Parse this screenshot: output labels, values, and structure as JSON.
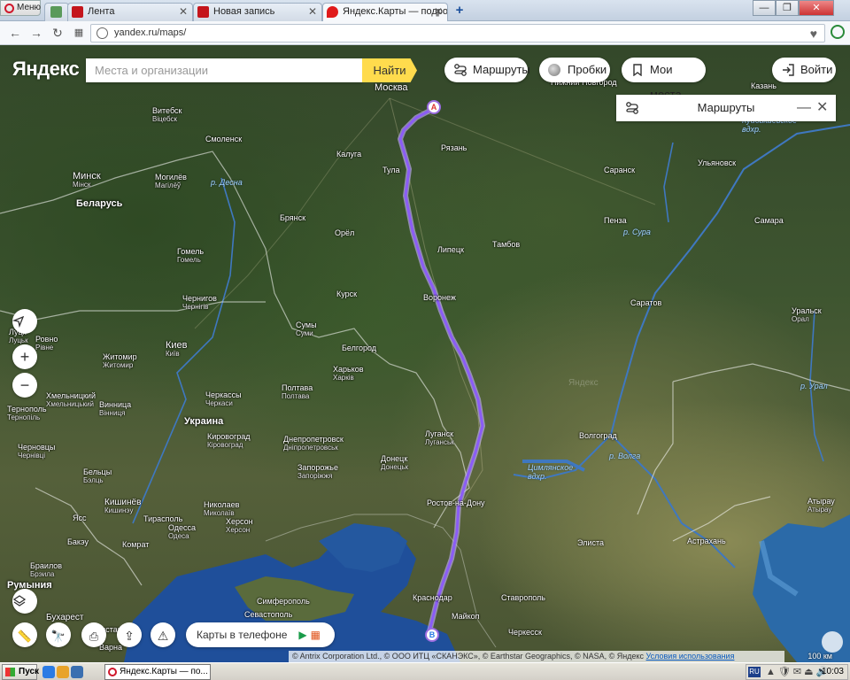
{
  "browser": {
    "menu_label": "Меню",
    "tabs": [
      {
        "label": "",
        "favicon": "speed-dial-icon"
      },
      {
        "label": "Лента",
        "favicon": "drive2-icon"
      },
      {
        "label": "Новая запись",
        "favicon": "drive2-icon"
      },
      {
        "label": "Яндекс.Карты — подробна",
        "favicon": "map-pin-icon"
      }
    ],
    "new_tab": "+",
    "url": "yandex.ru/maps/"
  },
  "header": {
    "logo": "Яндекс",
    "search_placeholder": "Места и организации",
    "find_label": "Найти",
    "routes_label": "Маршруты",
    "traffic_label": "Пробки",
    "myplaces_label": "Мои места",
    "login_label": "Войти"
  },
  "route_panel": {
    "title": "Маршруты"
  },
  "map": {
    "countries": [
      "Беларусь",
      "Украина",
      "Румыния"
    ],
    "water": [
      "р. Десна",
      "р. Сура",
      "р. Волга",
      "Цимлянское вдхр.",
      "Куйбышевское вдхр.",
      "р. Урал"
    ],
    "cities": [
      {
        "name": "Москва"
      },
      {
        "name": "Рязань"
      },
      {
        "name": "Калуга"
      },
      {
        "name": "Тула"
      },
      {
        "name": "Смоленск"
      },
      {
        "name": "Витебск",
        "sub": "Віцебск"
      },
      {
        "name": "Минск",
        "sub": "Мінск"
      },
      {
        "name": "Могилёв",
        "sub": "Магілёў"
      },
      {
        "name": "Брянск"
      },
      {
        "name": "Орёл"
      },
      {
        "name": "Липецк"
      },
      {
        "name": "Тамбов"
      },
      {
        "name": "Пенза"
      },
      {
        "name": "Саранск"
      },
      {
        "name": "Ульяновск"
      },
      {
        "name": "Самара"
      },
      {
        "name": "Казань"
      },
      {
        "name": "Нижний Новгород"
      },
      {
        "name": "Гомель",
        "sub": "Гомель"
      },
      {
        "name": "Курск"
      },
      {
        "name": "Воронеж"
      },
      {
        "name": "Саратов"
      },
      {
        "name": "Уральск",
        "sub": "Орал"
      },
      {
        "name": "Чернигов",
        "sub": "Чернігів"
      },
      {
        "name": "Сумы",
        "sub": "Суми"
      },
      {
        "name": "Белгород"
      },
      {
        "name": "Киев",
        "sub": "Київ"
      },
      {
        "name": "Житомир",
        "sub": "Житомир"
      },
      {
        "name": "Луцк",
        "sub": "Луцьк"
      },
      {
        "name": "Ровно",
        "sub": "Рівне"
      },
      {
        "name": "Харьков",
        "sub": "Харків"
      },
      {
        "name": "Полтава",
        "sub": "Полтава"
      },
      {
        "name": "Черкассы",
        "sub": "Черкаси"
      },
      {
        "name": "Хмельницкий",
        "sub": "Хмельницький"
      },
      {
        "name": "Винница",
        "sub": "Вінниця"
      },
      {
        "name": "Тернополь",
        "sub": "Тернопіль"
      },
      {
        "name": "Кировоград",
        "sub": "Кіровоград"
      },
      {
        "name": "Днепропетровск",
        "sub": "Дніпропетровськ"
      },
      {
        "name": "Луганск",
        "sub": "Луганськ"
      },
      {
        "name": "Донецк",
        "sub": "Донецьк"
      },
      {
        "name": "Запорожье",
        "sub": "Запоріжжя"
      },
      {
        "name": "Волгоград"
      },
      {
        "name": "Черновцы",
        "sub": "Чернівці"
      },
      {
        "name": "Бельцы",
        "sub": "Бэлць"
      },
      {
        "name": "Кишинёв",
        "sub": "Кишинэу"
      },
      {
        "name": "Николаев",
        "sub": "Миколаїв"
      },
      {
        "name": "Херсон",
        "sub": "Херсон"
      },
      {
        "name": "Одесса",
        "sub": "Одеса"
      },
      {
        "name": "Тирасполь"
      },
      {
        "name": "Ростов-на-Дону"
      },
      {
        "name": "Элиста"
      },
      {
        "name": "Астрахань"
      },
      {
        "name": "Атырау",
        "sub": "Атырау"
      },
      {
        "name": "Симферополь"
      },
      {
        "name": "Севастополь"
      },
      {
        "name": "Краснодар"
      },
      {
        "name": "Майкоп"
      },
      {
        "name": "Ставрополь"
      },
      {
        "name": "Черкесск"
      },
      {
        "name": "Бухарест"
      },
      {
        "name": "Констанца"
      },
      {
        "name": "Варна"
      },
      {
        "name": "Браилов",
        "sub": "Брэила"
      },
      {
        "name": "Комрат"
      },
      {
        "name": "Бакэу"
      },
      {
        "name": "Ясс"
      },
      {
        "name": "Ровно"
      }
    ],
    "marker_a": "A",
    "marker_b": "B",
    "watermark": "Яндекс"
  },
  "controls": {
    "locate": "locate-icon",
    "zoom_in": "+",
    "zoom_out": "−"
  },
  "app_banner": {
    "label": "Карты в телефоне",
    "icons": "  ▶ ▦"
  },
  "copyright": {
    "text": "© Antrix Corporation Ltd., © ООО ИТЦ «СКАНЭКС», © Earthstar Geographics, © NASA, © Яндекс",
    "link": "Условия использования"
  },
  "scale_label": "100 км",
  "taskbar": {
    "start": "Пуск",
    "task_label": "Яндекс.Карты — по...",
    "lang": "RU",
    "clock": "10:03"
  },
  "colors": {
    "route": "#8b5cf6",
    "accent": "#ffdb4d",
    "sea": "#1f4f9a"
  }
}
